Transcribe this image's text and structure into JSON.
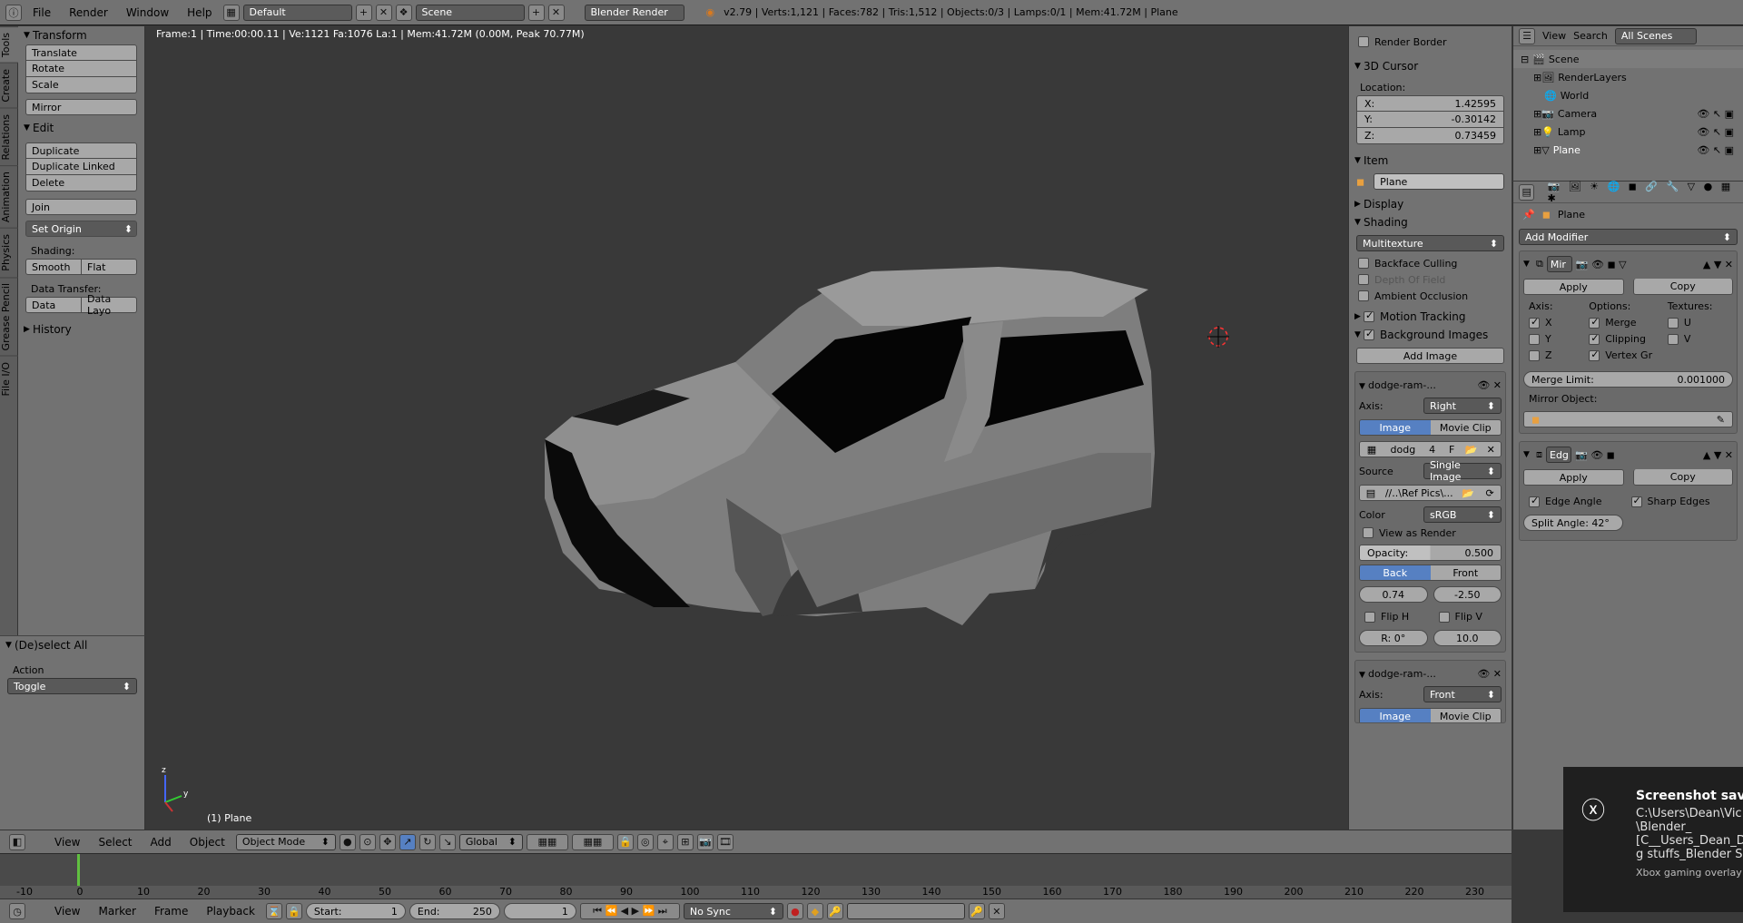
{
  "topbar": {
    "menus": [
      "File",
      "Render",
      "Window",
      "Help"
    ],
    "layout": "Default",
    "scene": "Scene",
    "engine": "Blender Render",
    "stats": "v2.79 | Verts:1,121 | Faces:782 | Tris:1,512 | Objects:0/3 | Lamps:0/1 | Mem:41.72M | Plane"
  },
  "left_tabs": [
    "Tools",
    "Create",
    "Relations",
    "Animation",
    "Physics",
    "Grease Pencil",
    "File I/O"
  ],
  "toolshelf": {
    "transform_title": "Transform",
    "translate": "Translate",
    "rotate": "Rotate",
    "scale": "Scale",
    "mirror": "Mirror",
    "edit_title": "Edit",
    "duplicate": "Duplicate",
    "duplicate_linked": "Duplicate Linked",
    "delete": "Delete",
    "join": "Join",
    "set_origin": "Set Origin",
    "shading_label": "Shading:",
    "smooth": "Smooth",
    "flat": "Flat",
    "data_transfer_label": "Data Transfer:",
    "data": "Data",
    "data_layout": "Data Layo",
    "history": "History",
    "deselect_title": "(De)select All",
    "action_label": "Action",
    "action_value": "Toggle"
  },
  "viewport": {
    "info": "Frame:1 | Time:00:00.11 | Ve:1121 Fa:1076 La:1 | Mem:41.72M (0.00M, Peak 70.77M)",
    "object_label": "(1) Plane"
  },
  "npanel": {
    "render_border": "Render Border",
    "cursor_title": "3D Cursor",
    "location_label": "Location:",
    "x_label": "X:",
    "x_value": "1.42595",
    "y_label": "Y:",
    "y_value": "-0.30142",
    "z_label": "Z:",
    "z_value": "0.73459",
    "item_title": "Item",
    "item_name": "Plane",
    "display_title": "Display",
    "shading_title": "Shading",
    "shading_mode": "Multitexture",
    "backface": "Backface Culling",
    "dof": "Depth Of Field",
    "ao": "Ambient Occlusion",
    "motion_tracking": "Motion Tracking",
    "bg_images": "Background Images",
    "add_image": "Add Image",
    "bg1_name": "dodge-ram-...",
    "axis_label": "Axis:",
    "bg1_axis": "Right",
    "image_tab": "Image",
    "movie_tab": "Movie Clip",
    "img_name": "dodg",
    "img_users": "4",
    "img_f": "F",
    "source_label": "Source",
    "source_value": "Single Image",
    "path_value": "//..\\Ref Pics\\...",
    "color_label": "Color",
    "color_value": "sRGB",
    "view_as_render": "View as Render",
    "opacity_label": "Opacity:",
    "opacity_value": "0.500",
    "back": "Back",
    "front": "Front",
    "offset_x": "0.74",
    "offset_y": "-2.50",
    "flip_h": "Flip H",
    "flip_v": "Flip V",
    "rotation": "R: 0°",
    "size": "10.0",
    "bg2_name": "dodge-ram-...",
    "bg2_axis": "Front",
    "image_tab2": "Image",
    "movie_tab2": "Movie Clip"
  },
  "outliner": {
    "view": "View",
    "search": "Search",
    "filter": "All Scenes",
    "items": [
      "Scene",
      "RenderLayers",
      "World",
      "Camera",
      "Lamp",
      "Plane"
    ]
  },
  "properties": {
    "breadcrumb": "Plane",
    "add_modifier": "Add Modifier",
    "mod1_name": "Mir",
    "apply": "Apply",
    "copy": "Copy",
    "axis_label": "Axis:",
    "options_label": "Options:",
    "textures_label": "Textures:",
    "x": "X",
    "y": "Y",
    "z": "Z",
    "merge": "Merge",
    "clipping": "Clipping",
    "vertex_gr": "Vertex Gr",
    "u": "U",
    "v": "V",
    "merge_limit_label": "Merge Limit:",
    "merge_limit_value": "0.001000",
    "mirror_object_label": "Mirror Object:",
    "mod2_name": "Edg",
    "apply2": "Apply",
    "copy2": "Copy",
    "edge_angle": "Edge Angle",
    "sharp_edges": "Sharp Edges",
    "split_angle": "Split Angle: 42°"
  },
  "vpheader": {
    "view": "View",
    "select": "Select",
    "add": "Add",
    "object": "Object",
    "mode": "Object Mode",
    "orientation": "Global"
  },
  "timeline": {
    "ticks": [
      "-10",
      "0",
      "10",
      "20",
      "30",
      "40",
      "50",
      "60",
      "70",
      "80",
      "90",
      "100",
      "110",
      "120",
      "130",
      "140",
      "150",
      "160",
      "170",
      "180",
      "190",
      "200",
      "210",
      "220",
      "230"
    ],
    "view": "View",
    "marker": "Marker",
    "frame": "Frame",
    "playback": "Playback",
    "start_label": "Start:",
    "start_value": "1",
    "end_label": "End:",
    "end_value": "250",
    "current": "1",
    "sync": "No Sync"
  },
  "toast": {
    "title": "Screenshot saved",
    "line1": "C:\\Users\\Dean\\Vic",
    "line2": "\\Blender_",
    "line3": "[C__Users_Dean_D",
    "line4": "g stuffs_Blender S",
    "footer": "Xbox gaming overlay"
  }
}
